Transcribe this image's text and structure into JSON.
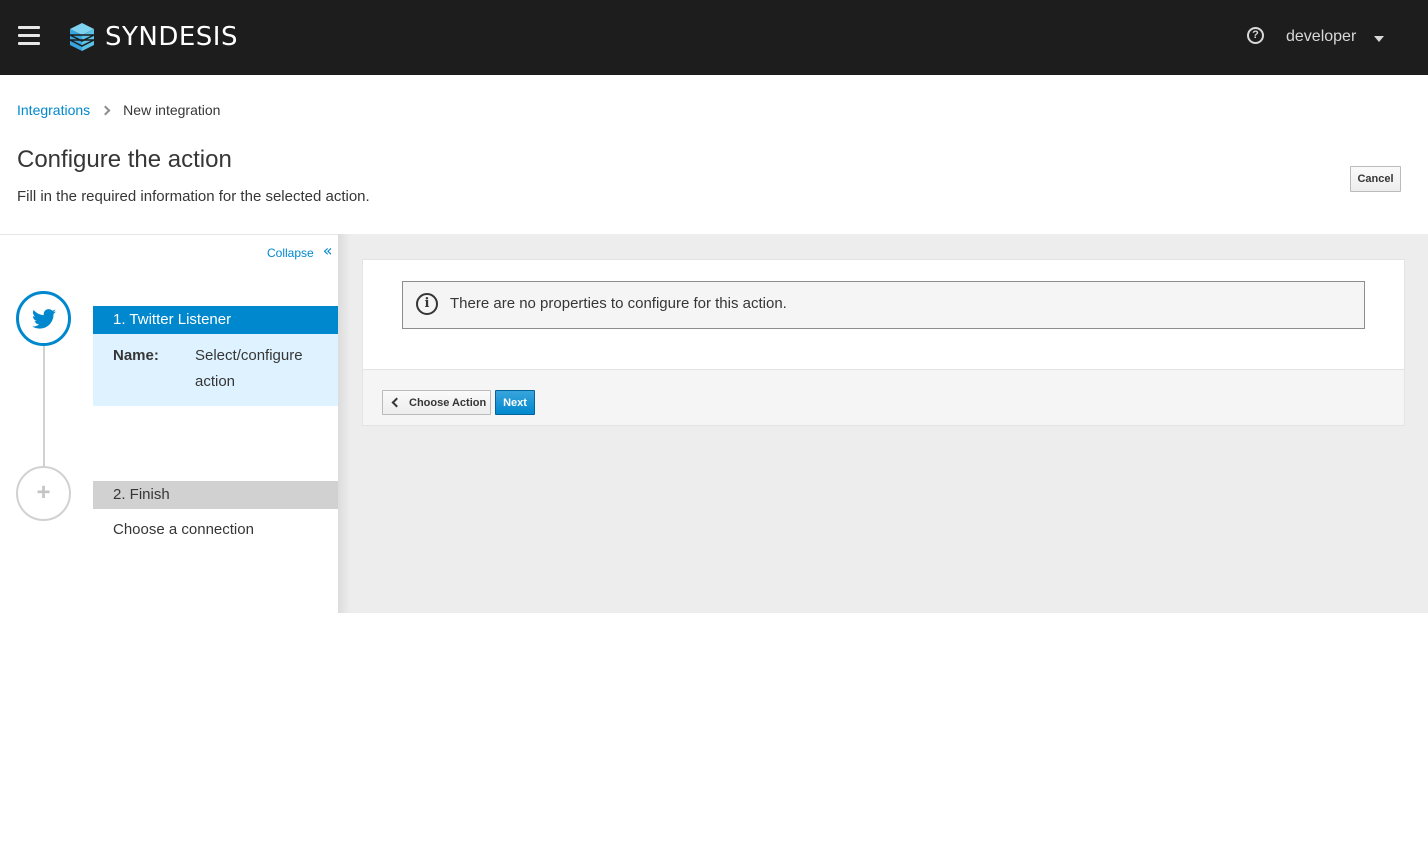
{
  "header": {
    "brand": "SYNDESIS",
    "user": "developer",
    "help_icon": "question-circle-icon",
    "menu_icon": "hamburger-icon"
  },
  "breadcrumb": {
    "link": "Integrations",
    "current": "New integration"
  },
  "page": {
    "title": "Configure the action",
    "description": "Fill in the required information for the selected action.",
    "cancel_label": "Cancel"
  },
  "steps_panel": {
    "collapse_label": "Collapse",
    "steps": [
      {
        "title": "1. Twitter Listener",
        "icon": "twitter-icon",
        "name_label": "Name:",
        "name_value": "Select/configure action"
      },
      {
        "title": "2. Finish",
        "icon": "plus-icon",
        "body": "Choose a connection"
      }
    ]
  },
  "content": {
    "info_text": "There are no properties to configure for this action.",
    "back_label": "Choose Action",
    "next_label": "Next"
  },
  "colors": {
    "accent": "#0088ce",
    "nav_bg": "#1d1d1d",
    "active_step_bg": "#def3ff",
    "inactive_step_bg": "#d1d1d1"
  }
}
